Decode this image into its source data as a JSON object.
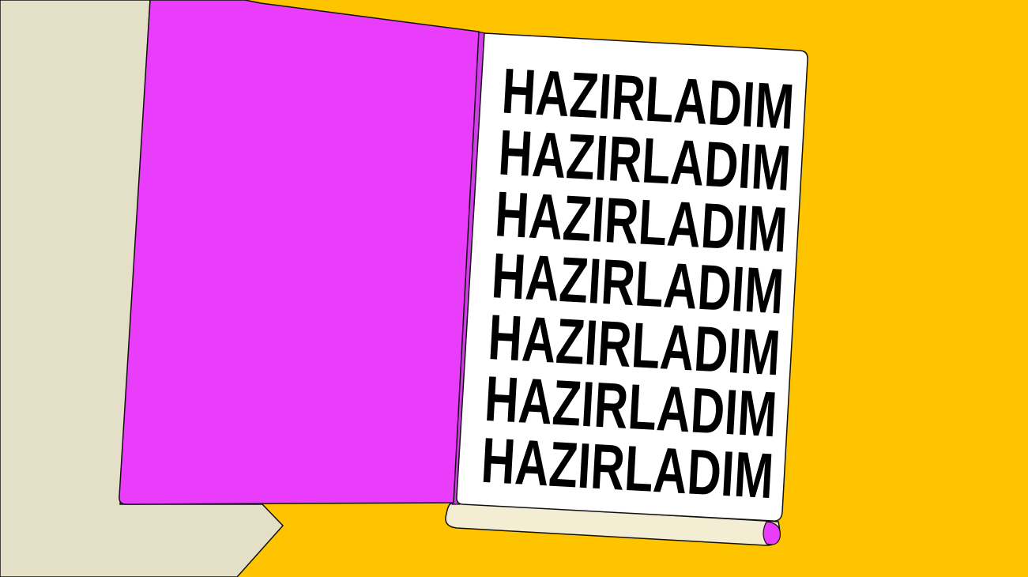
{
  "scene": {
    "colors": {
      "background": "#ffc400",
      "side_shape": "#e3e0c7",
      "folder_cover": "#e93dfb",
      "paper": "#ffffff",
      "paper_bottom": "#f2edd3",
      "outline": "#111111",
      "text": "#000000"
    },
    "icons": [
      "open-folder-icon"
    ]
  },
  "page": {
    "lines": [
      "HAZIRLADIM",
      "HAZIRLADIM",
      "HAZIRLADIM",
      "HAZIRLADIM",
      "HAZIRLADIM",
      "HAZIRLADIM",
      "HAZIRLADIM"
    ]
  }
}
